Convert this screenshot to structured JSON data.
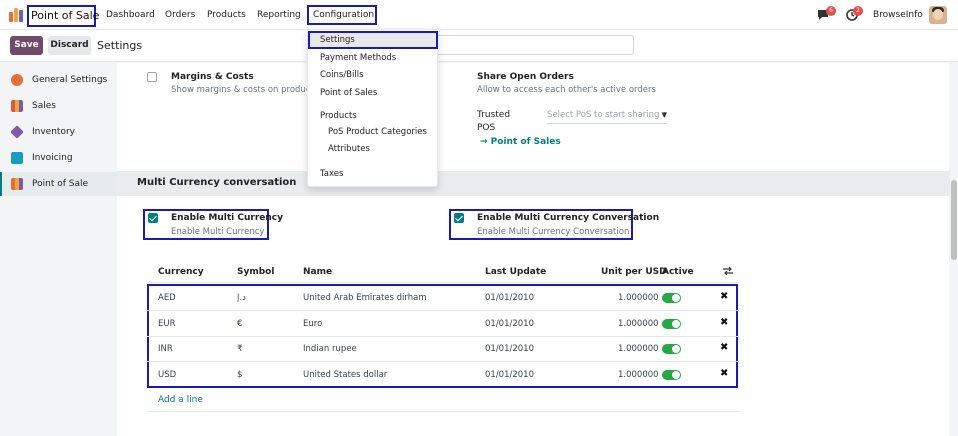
{
  "navbar": {
    "app_name": "Point of Sale",
    "menu": [
      "Dashboard",
      "Orders",
      "Products",
      "Reporting",
      "Configuration"
    ],
    "messages_badge": "6",
    "activity_badge": "2",
    "user": "BrowseInfo"
  },
  "control": {
    "save": "Save",
    "discard": "Discard",
    "breadcrumb": "Settings",
    "search_placeholder": ""
  },
  "sidebar": {
    "items": [
      {
        "label": "General Settings",
        "icon": "general-settings-icon",
        "color": "#e0713d"
      },
      {
        "label": "Sales",
        "icon": "sales-icon",
        "color": "#e05a3d"
      },
      {
        "label": "Inventory",
        "icon": "inventory-icon",
        "color": "#7d5ba6"
      },
      {
        "label": "Invoicing",
        "icon": "invoicing-icon",
        "color": "#1a9bc0"
      },
      {
        "label": "Point of Sale",
        "icon": "pos-icon",
        "color": "#e0713d"
      }
    ]
  },
  "settings": {
    "margins_title": "Margins & Costs",
    "margins_desc": "Show margins & costs on product",
    "share_title": "Share Open Orders",
    "share_desc": "Allow to access each other's active orders",
    "trusted_label_1": "Trusted",
    "trusted_label_2": "POS",
    "trusted_placeholder": "Select PoS to start sharing c",
    "pos_link": "→ Point of Sales"
  },
  "section": {
    "title": "Multi Currency conversation",
    "opt1_label": "Enable Multi Currency",
    "opt1_desc": "Enable Multi Currency",
    "opt2_label": "Enable Multi Currency Conversation",
    "opt2_desc": "Enable Multi Currency Conversation"
  },
  "table": {
    "headers": [
      "Currency",
      "Symbol",
      "Name",
      "Last Update",
      "Unit per USD",
      "Active"
    ],
    "rows": [
      {
        "currency": "AED",
        "symbol": "د.إ",
        "name": "United Arab Emirates dirham",
        "last_update": "01/01/2010",
        "unit": "1.000000",
        "active": true
      },
      {
        "currency": "EUR",
        "symbol": "€",
        "name": "Euro",
        "last_update": "01/01/2010",
        "unit": "1.000000",
        "active": true
      },
      {
        "currency": "INR",
        "symbol": "₹",
        "name": "Indian rupee",
        "last_update": "01/01/2010",
        "unit": "1.000000",
        "active": true
      },
      {
        "currency": "USD",
        "symbol": "$",
        "name": "United States dollar",
        "last_update": "01/01/2010",
        "unit": "1.000000",
        "active": true
      }
    ],
    "add_line": "Add a line"
  },
  "dropdown": {
    "items": [
      "Settings",
      "Payment Methods",
      "Coins/Bills",
      "Point of Sales"
    ],
    "products_header": "Products",
    "products_sub": [
      "PoS Product Categories",
      "Attributes"
    ],
    "taxes": "Taxes"
  },
  "colors": {
    "brand": "#714b67",
    "accent": "#017e84",
    "highlight": "#1a1ab8",
    "toggle_on": "#28a745"
  }
}
